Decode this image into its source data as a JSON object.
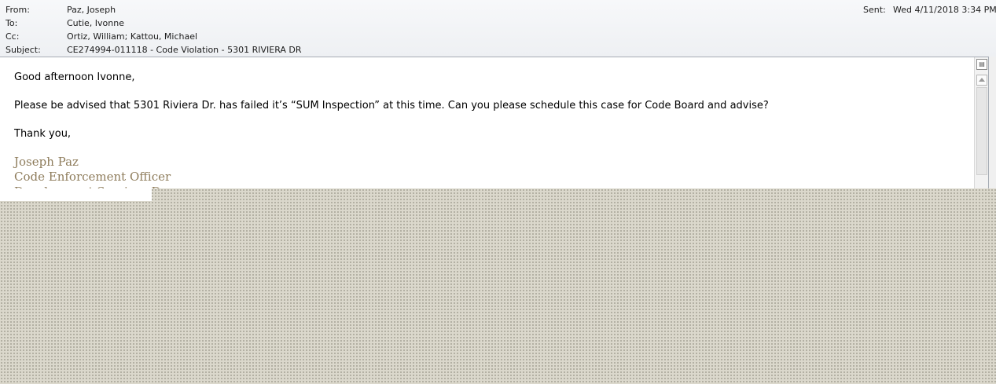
{
  "header": {
    "from_label": "From:",
    "from_value": "Paz, Joseph",
    "to_label": "To:",
    "to_value": "Cutie, Ivonne",
    "cc_label": "Cc:",
    "cc_value": "Ortiz, William; Kattou, Michael",
    "subject_label": "Subject:",
    "subject_value": "CE274994-011118 - Code Violation - 5301 RIVIERA DR",
    "sent_label": "Sent:",
    "sent_value": "Wed 4/11/2018 3:34 PM"
  },
  "body": {
    "greeting": "Good afternoon Ivonne,",
    "paragraph": "Please be advised that 5301 Riviera Dr. has failed it’s “SUM Inspection” at this time.  Can you please schedule this case for Code Board and advise?",
    "closing": "Thank you,"
  },
  "signature": {
    "name": "Joseph Paz",
    "title": "Code Enforcement Officer",
    "department": "Development Services Depa"
  },
  "colors": {
    "signature": "#8e7c5b",
    "dotted_background": "#dbd8cc"
  }
}
